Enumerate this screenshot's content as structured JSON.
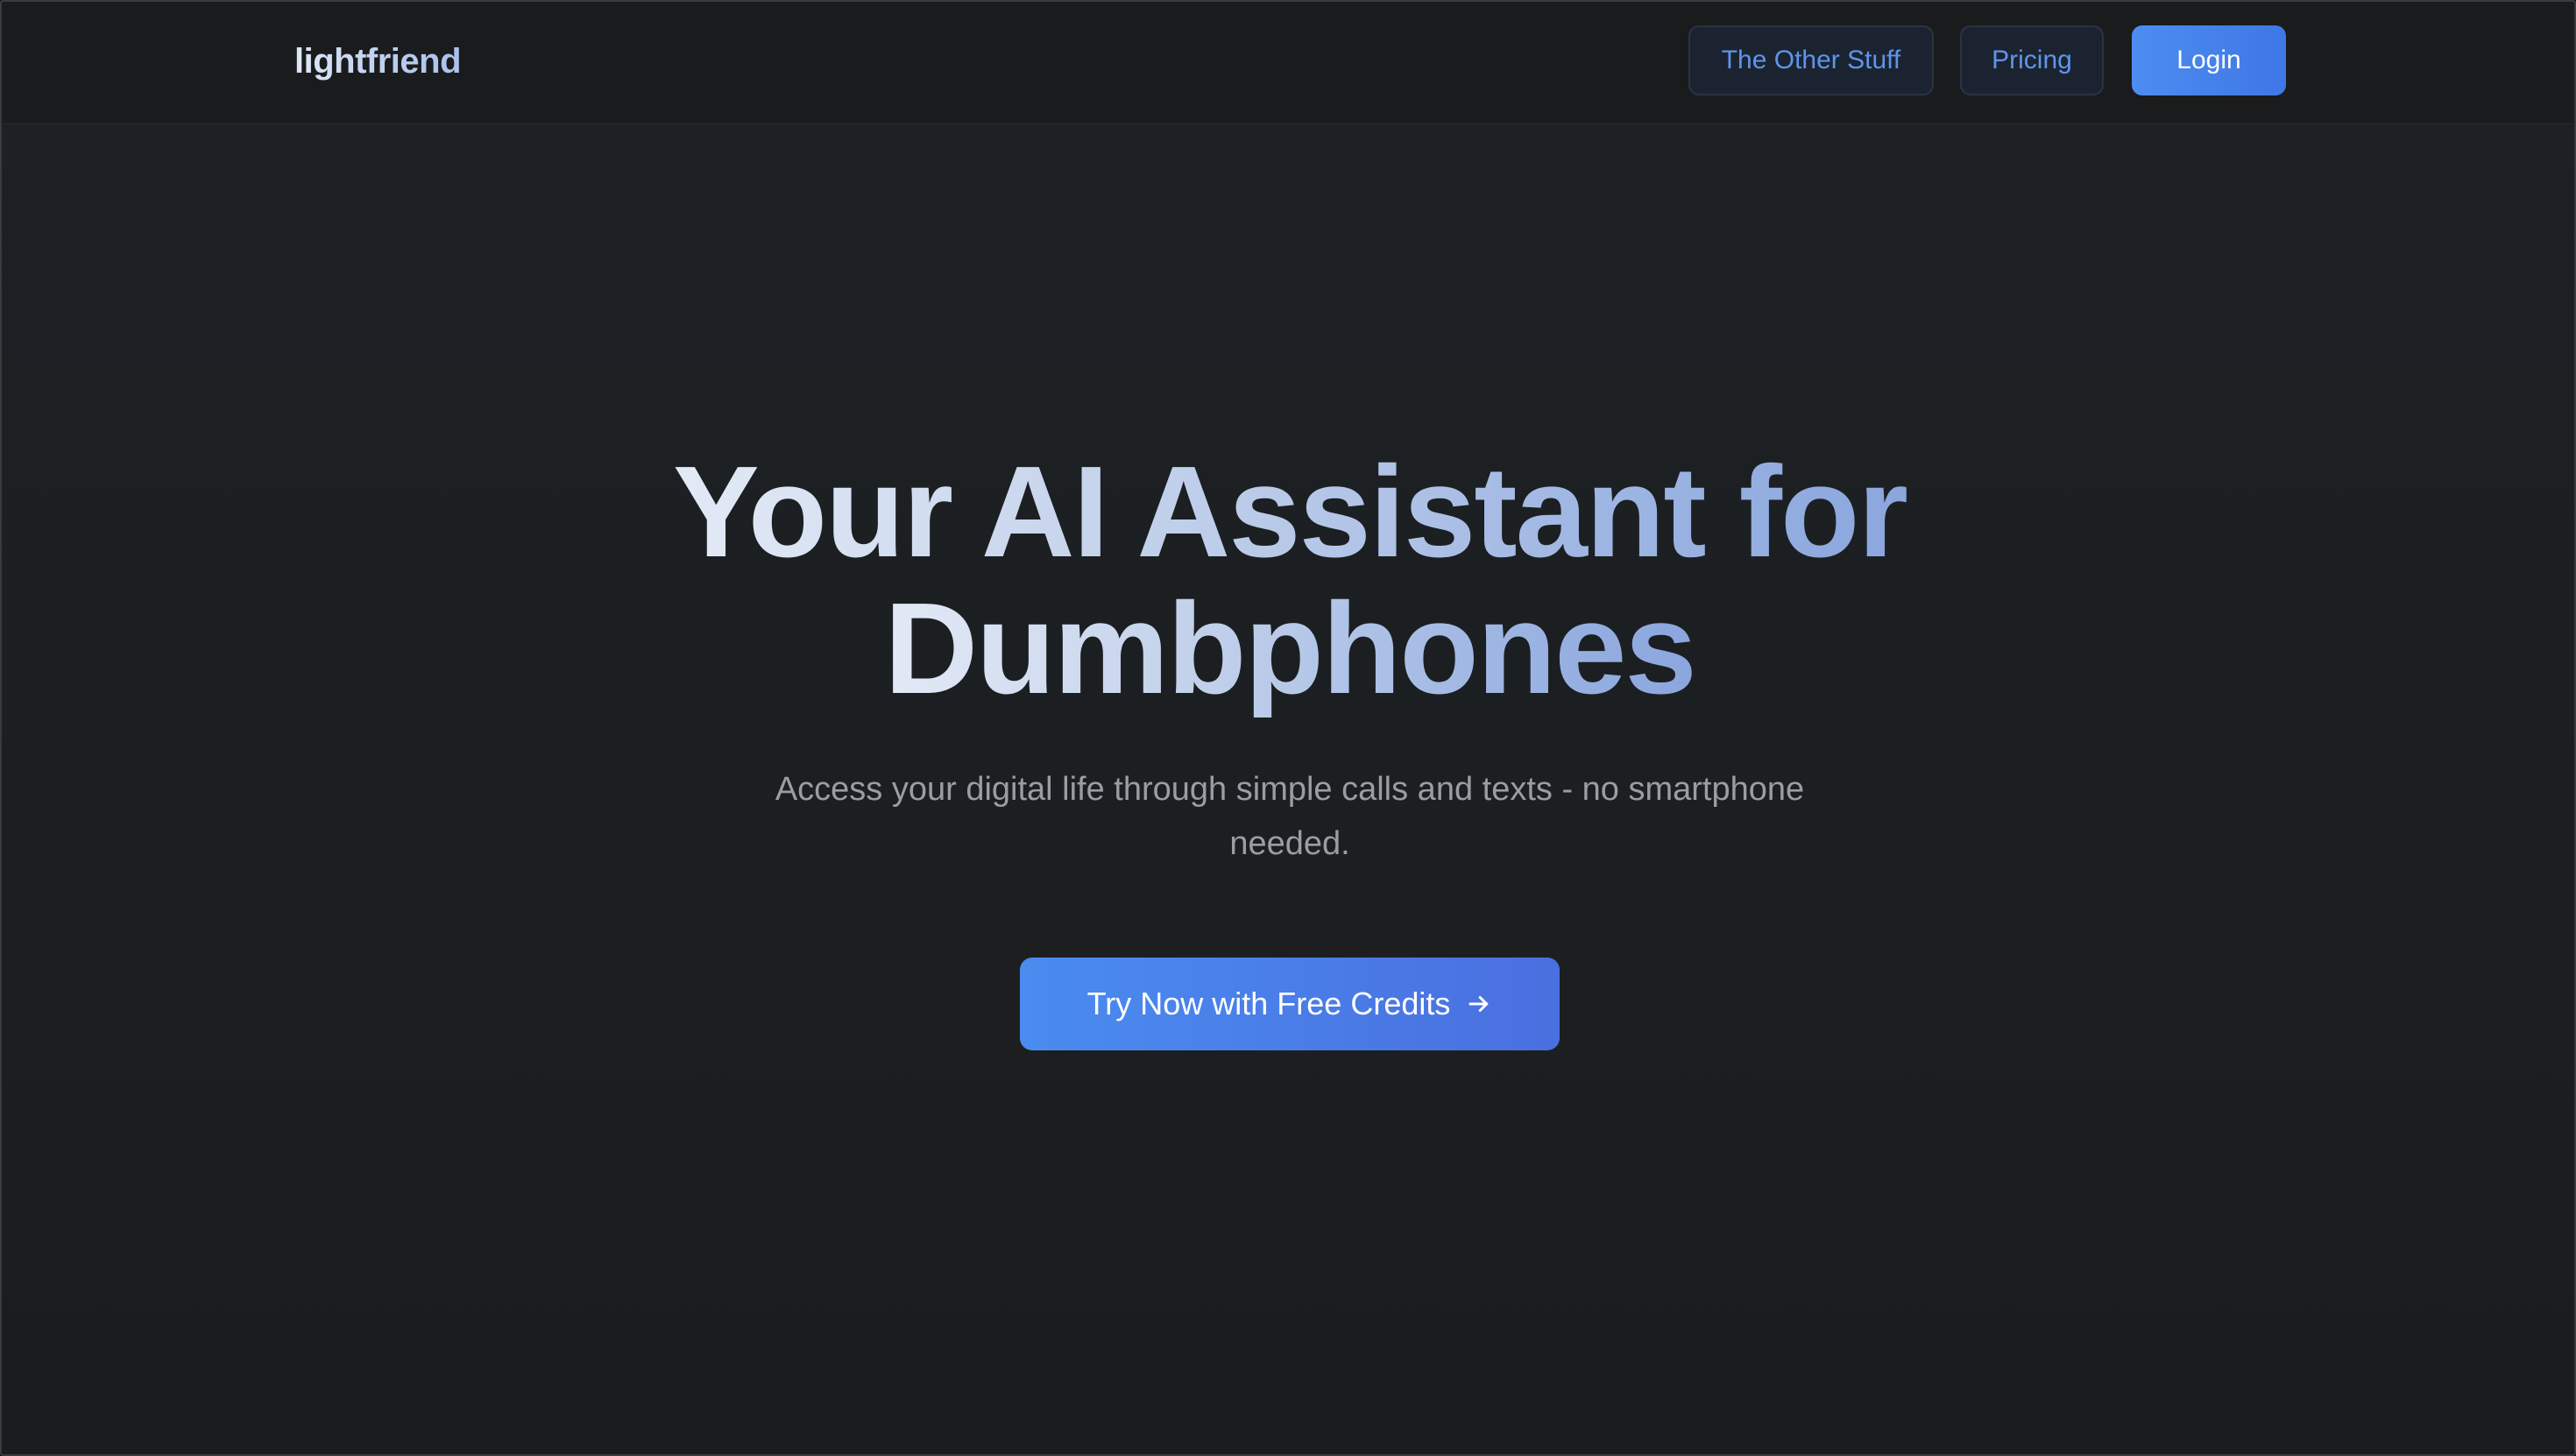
{
  "brand": {
    "name": "lightfriend"
  },
  "nav": {
    "other_label": "The Other Stuff",
    "pricing_label": "Pricing",
    "login_label": "Login"
  },
  "hero": {
    "title_line1": "Your AI Assistant for",
    "title_line2": "Dumbphones",
    "subtitle": "Access your digital life through simple calls and texts - no smartphone needed.",
    "cta_label": "Try Now with Free Credits",
    "cta_icon": "arrow-right-icon"
  },
  "colors": {
    "background": "#1b1c1d",
    "accent": "#4a8cf0",
    "ghost_button_text": "#5d95ec",
    "subtitle_text": "#9a9da2"
  }
}
